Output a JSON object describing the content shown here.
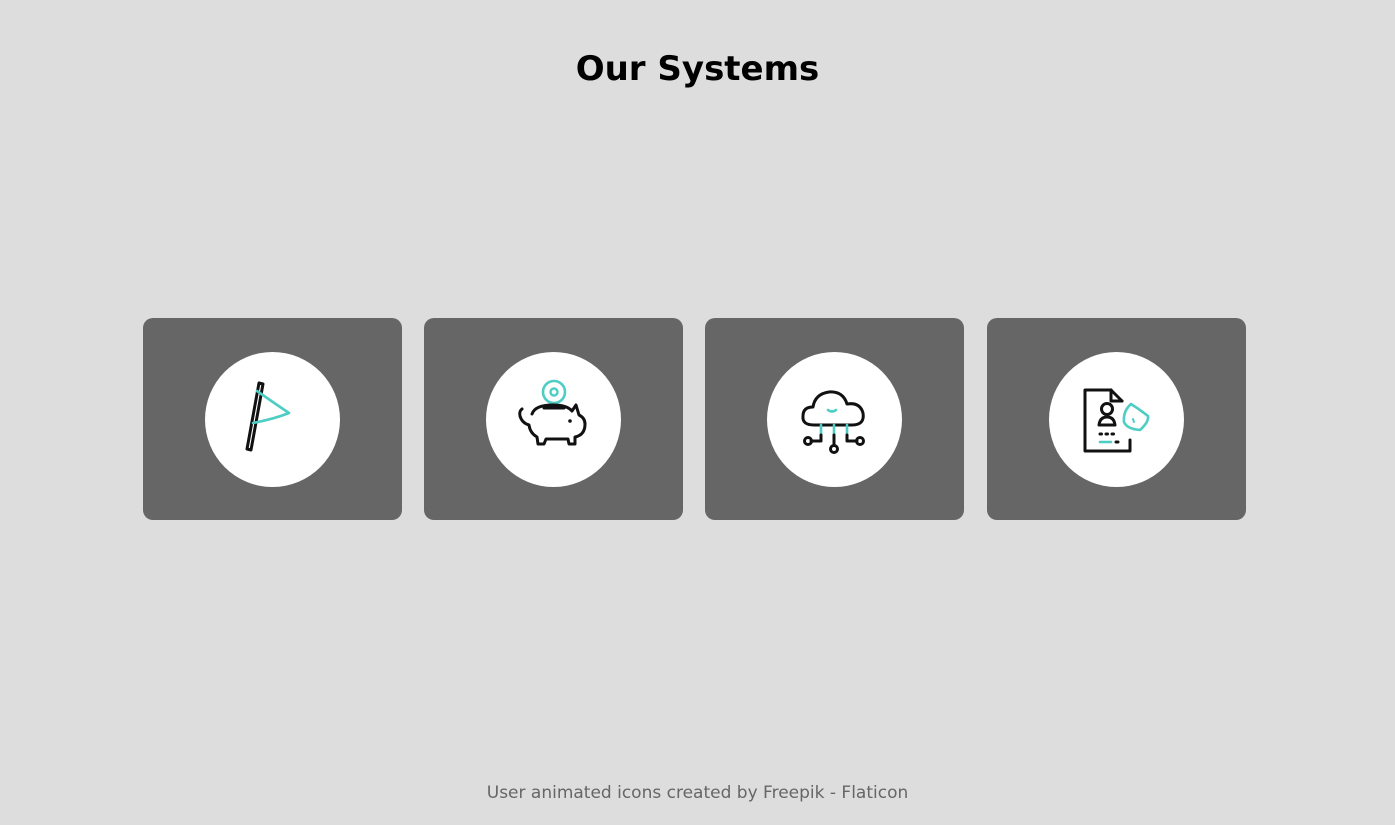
{
  "page": {
    "title": "Our Systems",
    "credit": "User animated icons created by Freepik - Flaticon"
  },
  "cards": [
    {
      "icon": "flag-icon"
    },
    {
      "icon": "piggy-bank-icon"
    },
    {
      "icon": "cloud-network-icon"
    },
    {
      "icon": "secure-profile-document-icon"
    }
  ],
  "colors": {
    "background": "#dddddd",
    "card": "#666666",
    "icon_circle": "#ffffff",
    "icon_stroke": "#111111",
    "icon_accent": "#4ecdc4",
    "credit_text": "#666666"
  }
}
